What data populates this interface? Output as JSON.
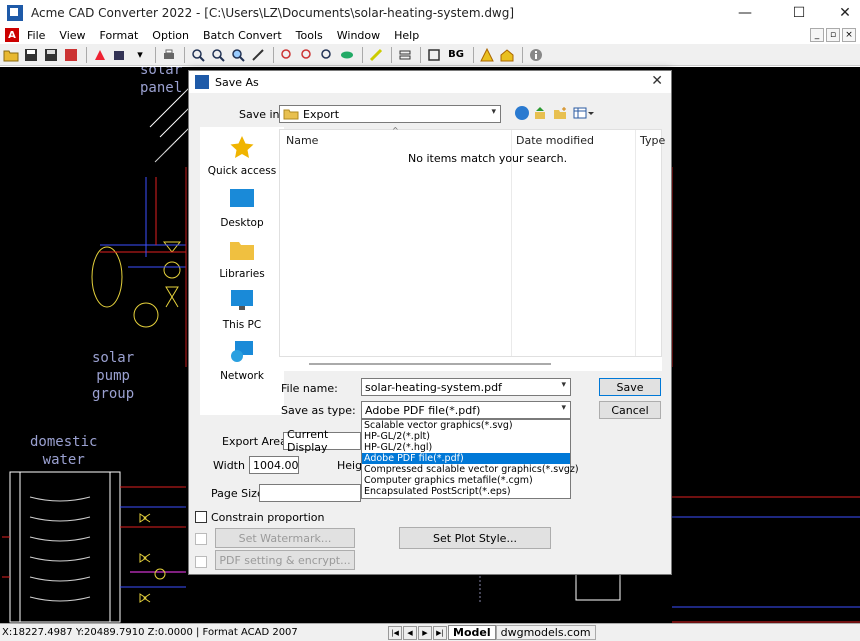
{
  "window": {
    "title": "Acme CAD Converter 2022 - [C:\\Users\\LZ\\Documents\\solar-heating-system.dwg]",
    "minimize": "—",
    "maximize": "☐",
    "close": "✕"
  },
  "menu": {
    "items": [
      "File",
      "View",
      "Format",
      "Option",
      "Batch Convert",
      "Tools",
      "Window",
      "Help"
    ]
  },
  "toolbar": {
    "bg_label": "BG"
  },
  "cad": {
    "labels": {
      "solar_panel": "solar\npanel",
      "solar_pump": "solar\npump\ngroup",
      "domestic_water": "domestic\nwater"
    }
  },
  "statusbar": {
    "coords": "X:18227.4987 Y:20489.7910 Z:0.0000 | Format ACAD 2007",
    "tab_model": "Model",
    "tab_other": "dwgmodels.com"
  },
  "dialog": {
    "title": "Save As",
    "save_in_label": "Save in:",
    "save_in_value": "Export",
    "places": [
      {
        "label": "Quick access",
        "icon": "star-icon"
      },
      {
        "label": "Desktop",
        "icon": "desktop-icon"
      },
      {
        "label": "Libraries",
        "icon": "libraries-icon"
      },
      {
        "label": "This PC",
        "icon": "pc-icon"
      },
      {
        "label": "Network",
        "icon": "network-icon"
      }
    ],
    "columns": [
      "Name",
      "Date modified",
      "Type"
    ],
    "empty_message": "No items match your search.",
    "file_name_label": "File name:",
    "file_name_value": "solar-heating-system.pdf",
    "save_type_label": "Save as type:",
    "save_type_value": "Adobe PDF file(*.pdf)",
    "save_button": "Save",
    "cancel_button": "Cancel",
    "type_options": [
      "Scalable vector graphics(*.svg)",
      "HP-GL/2(*.plt)",
      "HP-GL/2(*.hgl)",
      "Adobe PDF file(*.pdf)",
      "Compressed scalable vector graphics(*.svgz)",
      "Computer graphics metafile(*.cgm)",
      "Encapsulated PostScript(*.eps)"
    ],
    "selected_type_index": 3,
    "export_area_label": "Export Area",
    "export_area_value": "Current Display",
    "width_label": "Width",
    "width_value": "1004.00",
    "height_label": "Heigh",
    "page_size_label": "Page Size",
    "constrain_label": "Constrain proportion",
    "watermark_button": "Set Watermark...",
    "pdf_setting_button": "PDF setting & encrypt...",
    "plot_style_button": "Set Plot Style..."
  },
  "colors": {
    "selection": "#0078d7",
    "canvas": "#000000",
    "cad_text": "#9aa0d0"
  }
}
